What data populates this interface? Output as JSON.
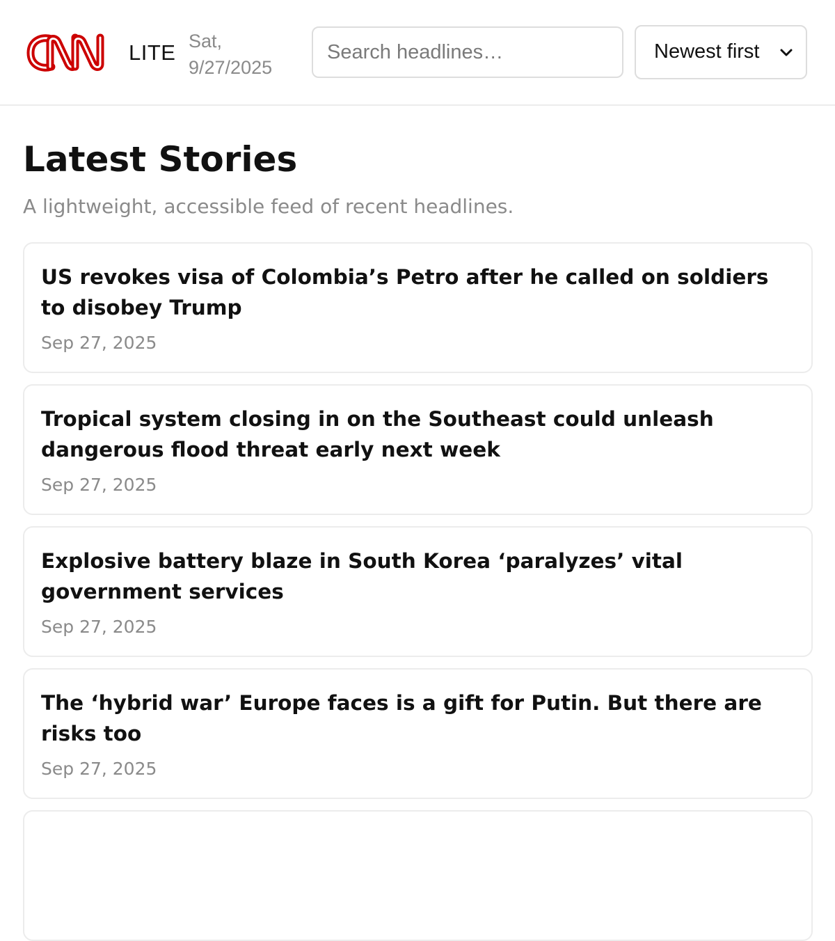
{
  "header": {
    "logo_text": "CNN",
    "lite_label": "LITE",
    "date_day": "Sat,",
    "date_full": "9/27/2025",
    "search_placeholder": "Search headlines…",
    "search_value": "",
    "sort_selected": "Newest first"
  },
  "main": {
    "title": "Latest Stories",
    "subtitle": "A lightweight, accessible feed of recent headlines."
  },
  "stories": [
    {
      "title": "US revokes visa of Colombia’s Petro after he called on soldiers to disobey Trump",
      "date": "Sep 27, 2025"
    },
    {
      "title": "Tropical system closing in on the Southeast could unleash dangerous flood threat early next week",
      "date": "Sep 27, 2025"
    },
    {
      "title": "Explosive battery blaze in South Korea ‘paralyzes’ vital government services",
      "date": "Sep 27, 2025"
    },
    {
      "title": "The ‘hybrid war’ Europe faces is a gift for Putin. But there are risks too",
      "date": "Sep 27, 2025"
    }
  ],
  "colors": {
    "brand_red": "#cc0000",
    "text_primary": "#111111",
    "text_muted": "#8a8a8a",
    "border": "#ececec"
  }
}
